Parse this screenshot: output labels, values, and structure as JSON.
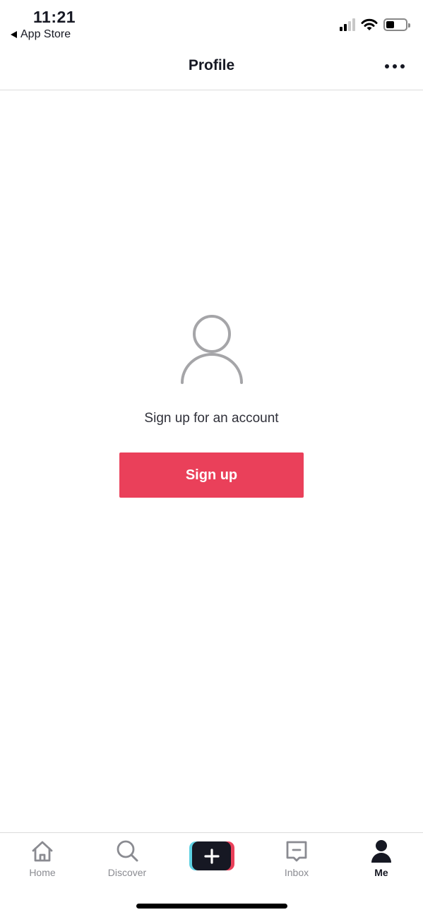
{
  "status_bar": {
    "time": "11:21",
    "back_app": "App Store",
    "signal_bars_active": 2,
    "signal_bars_total": 4,
    "battery_level_percent": 35
  },
  "header": {
    "title": "Profile",
    "more_icon": "more-horizontal-icon"
  },
  "empty_state": {
    "icon": "person-outline-icon",
    "prompt": "Sign up for an account",
    "signup_label": "Sign up"
  },
  "tab_bar": {
    "items": [
      {
        "label": "Home",
        "icon": "home-icon",
        "active": false
      },
      {
        "label": "Discover",
        "icon": "search-icon",
        "active": false
      },
      {
        "label": "",
        "icon": "create-plus-icon",
        "active": false
      },
      {
        "label": "Inbox",
        "icon": "inbox-icon",
        "active": false
      },
      {
        "label": "Me",
        "icon": "person-icon",
        "active": true
      }
    ]
  },
  "colors": {
    "accent": "#ea405a",
    "cyan": "#5dd0e2",
    "dark": "#161823",
    "inactive": "#8a8b91"
  }
}
